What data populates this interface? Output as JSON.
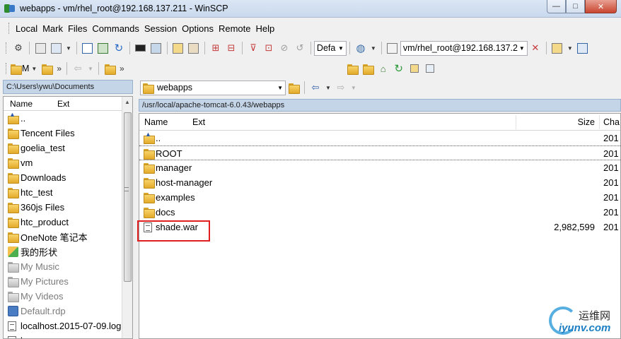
{
  "window": {
    "title": "webapps - vm/rhel_root@192.168.137.211 - WinSCP",
    "buttons": {
      "minimize": "—",
      "maximize": "□",
      "close": "✕"
    }
  },
  "menu": [
    "Local",
    "Mark",
    "Files",
    "Commands",
    "Session",
    "Options",
    "Remote",
    "Help"
  ],
  "toolbar1": {
    "transfer_combo": "Defa",
    "session_combo": "vm/rhel_root@192.168.137.2"
  },
  "toolbar2": {
    "left_combo": "M"
  },
  "left_pane": {
    "path": "C:\\Users\\ywu\\Documents",
    "columns": [
      "Name",
      "Ext"
    ],
    "items": [
      {
        "name": "..",
        "icon": "parent-folder-icon",
        "dim": false
      },
      {
        "name": "Tencent Files",
        "icon": "folder-icon",
        "dim": false
      },
      {
        "name": "goelia_test",
        "icon": "folder-icon",
        "dim": false
      },
      {
        "name": "vm",
        "icon": "folder-icon",
        "dim": false
      },
      {
        "name": "Downloads",
        "icon": "folder-icon",
        "dim": false
      },
      {
        "name": "htc_test",
        "icon": "folder-icon",
        "dim": false
      },
      {
        "name": "360js Files",
        "icon": "folder-icon",
        "dim": false
      },
      {
        "name": "htc_product",
        "icon": "folder-icon",
        "dim": false
      },
      {
        "name": "OneNote 笔记本",
        "icon": "folder-icon",
        "dim": false
      },
      {
        "name": "我的形状",
        "icon": "shapes-icon",
        "dim": false
      },
      {
        "name": "My Music",
        "icon": "music-folder-icon",
        "dim": true
      },
      {
        "name": "My Pictures",
        "icon": "pictures-folder-icon",
        "dim": true
      },
      {
        "name": "My Videos",
        "icon": "videos-folder-icon",
        "dim": true
      },
      {
        "name": "Default.rdp",
        "icon": "rdp-file-icon",
        "dim": true
      },
      {
        "name": "localhost.2015-07-09.log",
        "icon": "file-icon",
        "dim": false
      },
      {
        "name": "l...",
        "icon": "file-icon",
        "dim": false
      }
    ]
  },
  "right_pane": {
    "combo": "webapps",
    "path": "/usr/local/apache-tomcat-6.0.43/webapps",
    "columns": {
      "name": "Name",
      "ext": "Ext",
      "size": "Size",
      "changed": "Cha"
    },
    "items": [
      {
        "name": "..",
        "icon": "parent-folder-icon",
        "size": "",
        "changed": "201"
      },
      {
        "name": "ROOT",
        "icon": "folder-icon",
        "size": "",
        "changed": "201"
      },
      {
        "name": "manager",
        "icon": "folder-icon",
        "size": "",
        "changed": "201"
      },
      {
        "name": "host-manager",
        "icon": "folder-icon",
        "size": "",
        "changed": "201"
      },
      {
        "name": "examples",
        "icon": "folder-icon",
        "size": "",
        "changed": "201"
      },
      {
        "name": "docs",
        "icon": "folder-icon",
        "size": "",
        "changed": "201"
      },
      {
        "name": "shade.war",
        "icon": "file-icon",
        "size": "2,982,599",
        "changed": "201"
      }
    ]
  },
  "watermark": {
    "cn": "运维网",
    "en": "iyunv.com"
  },
  "colors": {
    "highlight": "#e02020",
    "path_bar": "#c5d5e8"
  }
}
